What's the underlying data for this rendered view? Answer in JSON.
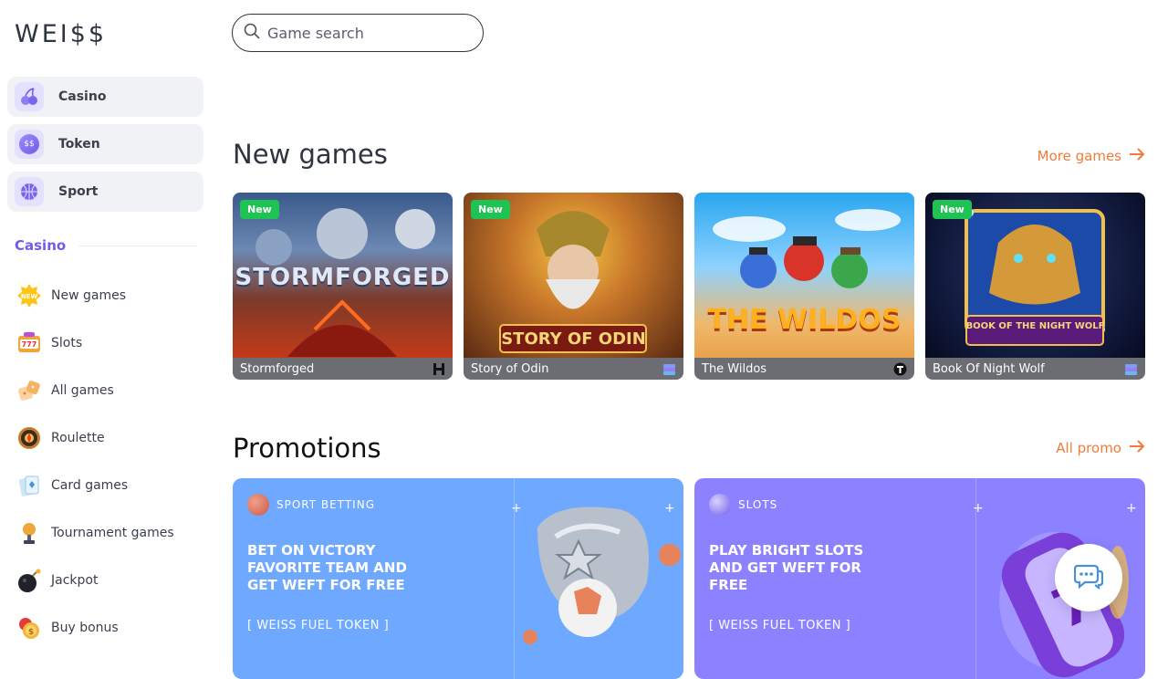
{
  "brand": {
    "logo_text": "WEI$$"
  },
  "search": {
    "placeholder": "Game search"
  },
  "main_nav": [
    {
      "label": "Casino",
      "icon": "cherry-icon"
    },
    {
      "label": "Token",
      "icon": "token-coin-icon"
    },
    {
      "label": "Sport",
      "icon": "basketball-icon"
    }
  ],
  "casino_section": {
    "title": "Casino"
  },
  "categories": [
    {
      "label": "New games",
      "icon": "new-badge-icon"
    },
    {
      "label": "Slots",
      "icon": "slot-777-icon"
    },
    {
      "label": "All games",
      "icon": "dice-icon"
    },
    {
      "label": "Roulette",
      "icon": "roulette-icon"
    },
    {
      "label": "Card games",
      "icon": "cards-icon"
    },
    {
      "label": "Tournament games",
      "icon": "trophy-icon"
    },
    {
      "label": "Jackpot",
      "icon": "bomb-icon"
    },
    {
      "label": "Buy bonus",
      "icon": "coins-icon"
    }
  ],
  "new_games": {
    "title": "New games",
    "more_label": "More games",
    "games": [
      {
        "name": "Stormforged",
        "badge": "New",
        "art_text": "STORMFORGED",
        "provider_icon": "provider-h-icon"
      },
      {
        "name": "Story of Odin",
        "badge": "New",
        "art_text": "STORY OF ODIN",
        "provider_icon": "provider-stack-icon"
      },
      {
        "name": "The Wildos",
        "badge": "",
        "art_text": "THE WILDOS",
        "provider_icon": "provider-shield-icon"
      },
      {
        "name": "Book Of Night Wolf",
        "badge": "New",
        "art_text": "BOOK OF THE NIGHT WOLF",
        "provider_icon": "provider-stack-icon"
      }
    ]
  },
  "promotions": {
    "title": "Promotions",
    "all_label": "All promo",
    "items": [
      {
        "tag": "SPORT BETTING",
        "headline": "BET ON VICTORY FAVORITE TEAM AND GET WEFT FOR FREE",
        "sub": "[ WEISS FUEL TOKEN ]",
        "color": "#6ea8ff"
      },
      {
        "tag": "SLOTS",
        "headline": "PLAY BRIGHT SLOTS AND GET WEFT FOR FREE",
        "sub": "[ WEISS FUEL TOKEN ]",
        "color": "#8c82ff"
      }
    ]
  },
  "colors": {
    "accent": "#6f5de8",
    "link": "#ef7c3a",
    "new_badge": "#1fc354"
  }
}
